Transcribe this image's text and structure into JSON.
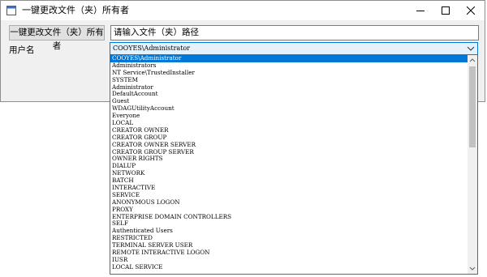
{
  "window": {
    "title": "一键更改文件（夹）所有者"
  },
  "toolbar": {
    "change_owner_label": "一键更改文件（夹）所有者",
    "path_value": "请输入文件（夹）路径"
  },
  "user": {
    "label": "用户名",
    "selected": "COOYES\\Administrator"
  },
  "dropdown": {
    "items": [
      "COOYES\\Administrator",
      "Administrators",
      "NT Service\\TrustedInstaller",
      "SYSTEM",
      "Administrator",
      "DefaultAccount",
      "Guest",
      "WDAGUtilityAccount",
      "Everyone",
      "LOCAL",
      "CREATOR OWNER",
      "CREATOR GROUP",
      "CREATOR OWNER SERVER",
      "CREATOR GROUP SERVER",
      "OWNER RIGHTS",
      "DIALUP",
      "NETWORK",
      "BATCH",
      "INTERACTIVE",
      "SERVICE",
      "ANONYMOUS LOGON",
      "PROXY",
      "ENTERPRISE DOMAIN CONTROLLERS",
      "SELF",
      "Authenticated Users",
      "RESTRICTED",
      "TERMINAL SERVER USER",
      "REMOTE INTERACTIVE LOGON",
      "IUSR",
      "LOCAL SERVICE"
    ],
    "selected_index": 0
  }
}
